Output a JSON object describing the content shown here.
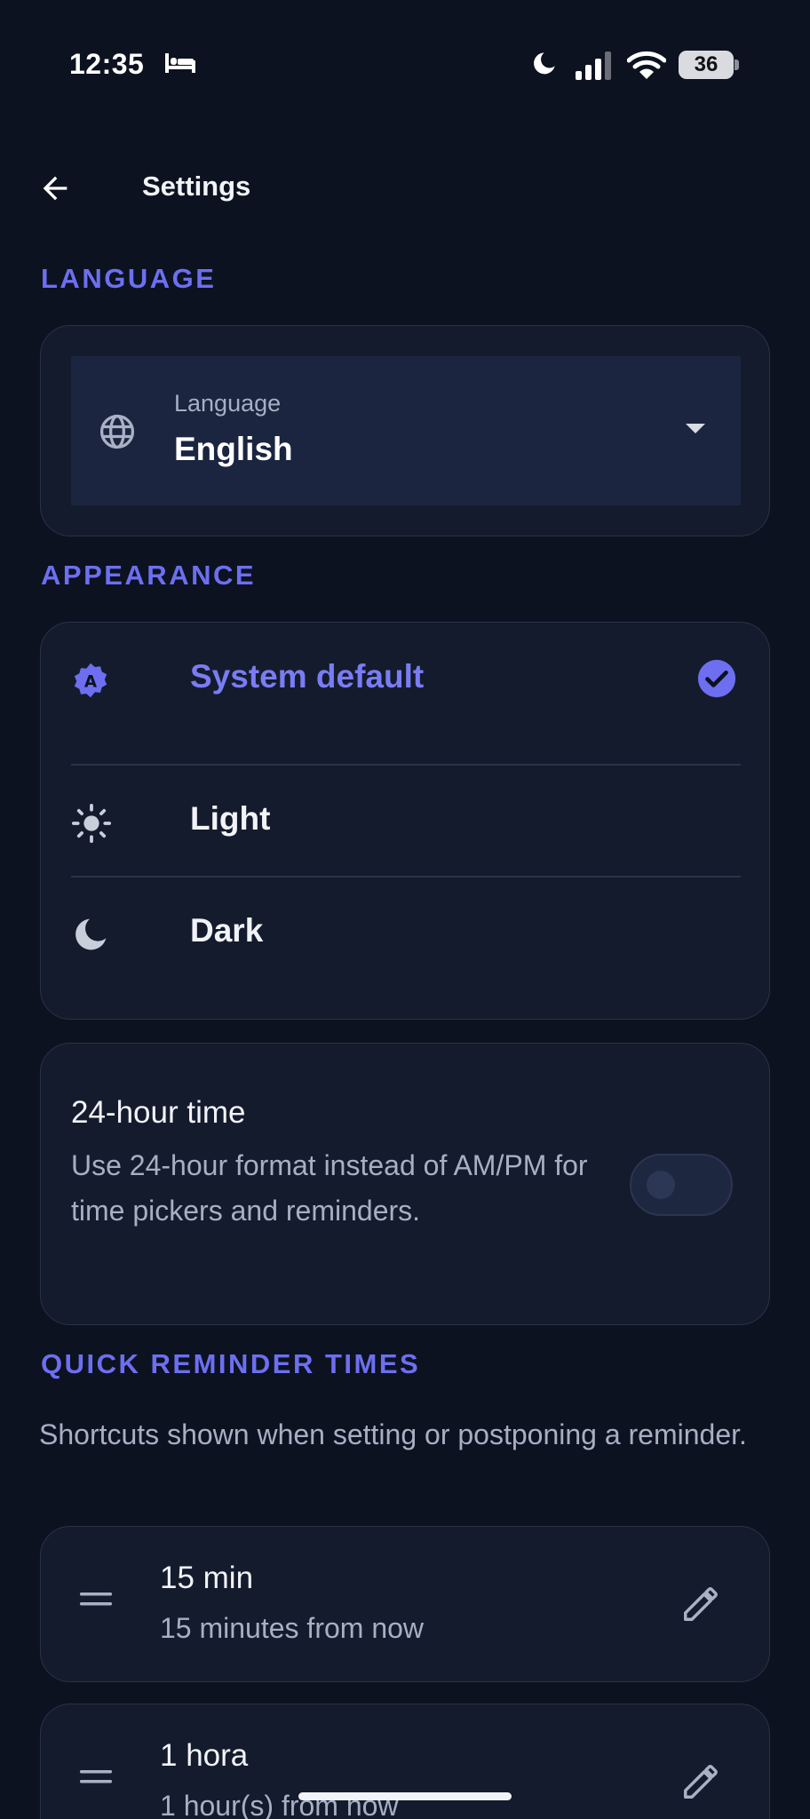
{
  "status_bar": {
    "time": "12:35",
    "battery": "36"
  },
  "app_bar": {
    "title": "Settings"
  },
  "language_section": {
    "header": "LANGUAGE",
    "field_label": "Language",
    "selected_value": "English"
  },
  "appearance_section": {
    "header": "APPEARANCE",
    "options": [
      {
        "label": "System default",
        "icon": "auto-theme-icon",
        "selected": true
      },
      {
        "label": "Light",
        "icon": "sun-icon",
        "selected": false
      },
      {
        "label": "Dark",
        "icon": "moon-icon",
        "selected": false
      }
    ]
  },
  "time_format": {
    "title": "24-hour time",
    "description": "Use 24-hour format instead of AM/PM for time pickers and reminders.",
    "enabled": false
  },
  "quick_reminders": {
    "header": "QUICK REMINDER TIMES",
    "description": "Shortcuts shown when setting or postponing a reminder.",
    "items": [
      {
        "title": "15 min",
        "subtitle": "15 minutes from now"
      },
      {
        "title": "1 hora",
        "subtitle": "1 hour(s) from now"
      }
    ]
  },
  "colors": {
    "accent": "#6d6ff0",
    "background": "#0c1220",
    "card": "#141b2c",
    "field": "#1b2540"
  }
}
